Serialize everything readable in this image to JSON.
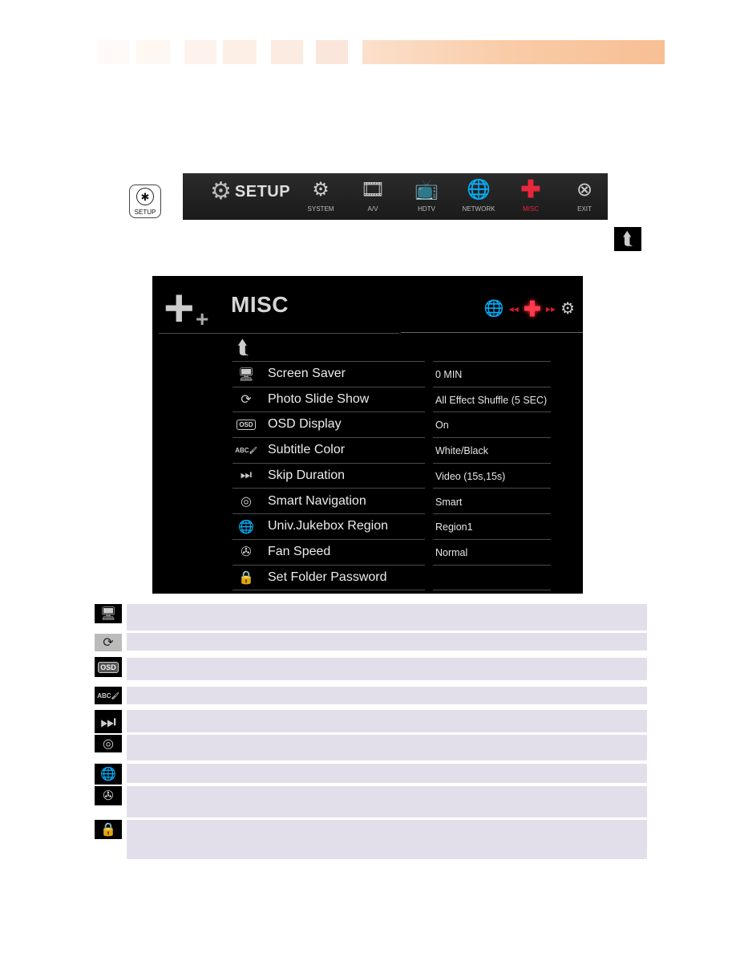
{
  "header": {
    "decor_color": "#f7bf94"
  },
  "remote": {
    "setup_key_label": "SETUP"
  },
  "menu_bar": {
    "title": "SETUP",
    "items": [
      {
        "label": "SYSTEM",
        "icon": "gears-icon",
        "active": false
      },
      {
        "label": "A/V",
        "icon": "film-speaker-icon",
        "active": false
      },
      {
        "label": "HDTV",
        "icon": "tv-icon",
        "active": false
      },
      {
        "label": "NETWORK",
        "icon": "globe-icon",
        "active": false
      },
      {
        "label": "MISC",
        "icon": "plus-icon",
        "active": true
      },
      {
        "label": "EXIT",
        "icon": "close-circle-icon",
        "active": false
      }
    ],
    "active_color": "#e8263c"
  },
  "screen": {
    "title": "MISC",
    "breadcrumb": {
      "prev": "globe-icon",
      "current": "plus-icon",
      "next": "gears-icon"
    },
    "settings": [
      {
        "icon": "monitor-smile-icon",
        "label": "Screen Saver",
        "value": "0 MIN"
      },
      {
        "icon": "slideshow-icon",
        "label": "Photo Slide Show",
        "value": "All Effect Shuffle (5 SEC)"
      },
      {
        "icon": "osd-icon",
        "label": "OSD Display",
        "value": "On"
      },
      {
        "icon": "abc-brush-icon",
        "label": "Subtitle Color",
        "value": "White/Black"
      },
      {
        "icon": "skip-next-icon",
        "label": "Skip Duration",
        "value": "Video (15s,15s)"
      },
      {
        "icon": "disc-icon",
        "label": "Smart Navigation",
        "value": "Smart"
      },
      {
        "icon": "globe-disc-icon",
        "label": "Univ.Jukebox Region",
        "value": "Region1"
      },
      {
        "icon": "fan-icon",
        "label": "Fan Speed",
        "value": "Normal"
      },
      {
        "icon": "lock-icon",
        "label": "Set Folder Password",
        "value": ""
      }
    ],
    "osd_icon_text": "OSD",
    "abc_icon_text": "ABC"
  },
  "descriptions": [
    {
      "icon": "monitor-smile-icon",
      "text": ""
    },
    {
      "icon": "slideshow-icon",
      "text": ""
    },
    {
      "icon": "osd-icon",
      "text": ""
    },
    {
      "icon": "abc-brush-icon",
      "text": ""
    },
    {
      "icon": "skip-next-icon",
      "text": ""
    },
    {
      "icon": "disc-icon",
      "text": ""
    },
    {
      "icon": "globe-disc-icon",
      "text": ""
    },
    {
      "icon": "fan-icon",
      "text": ""
    },
    {
      "icon": "lock-icon",
      "text": ""
    }
  ]
}
